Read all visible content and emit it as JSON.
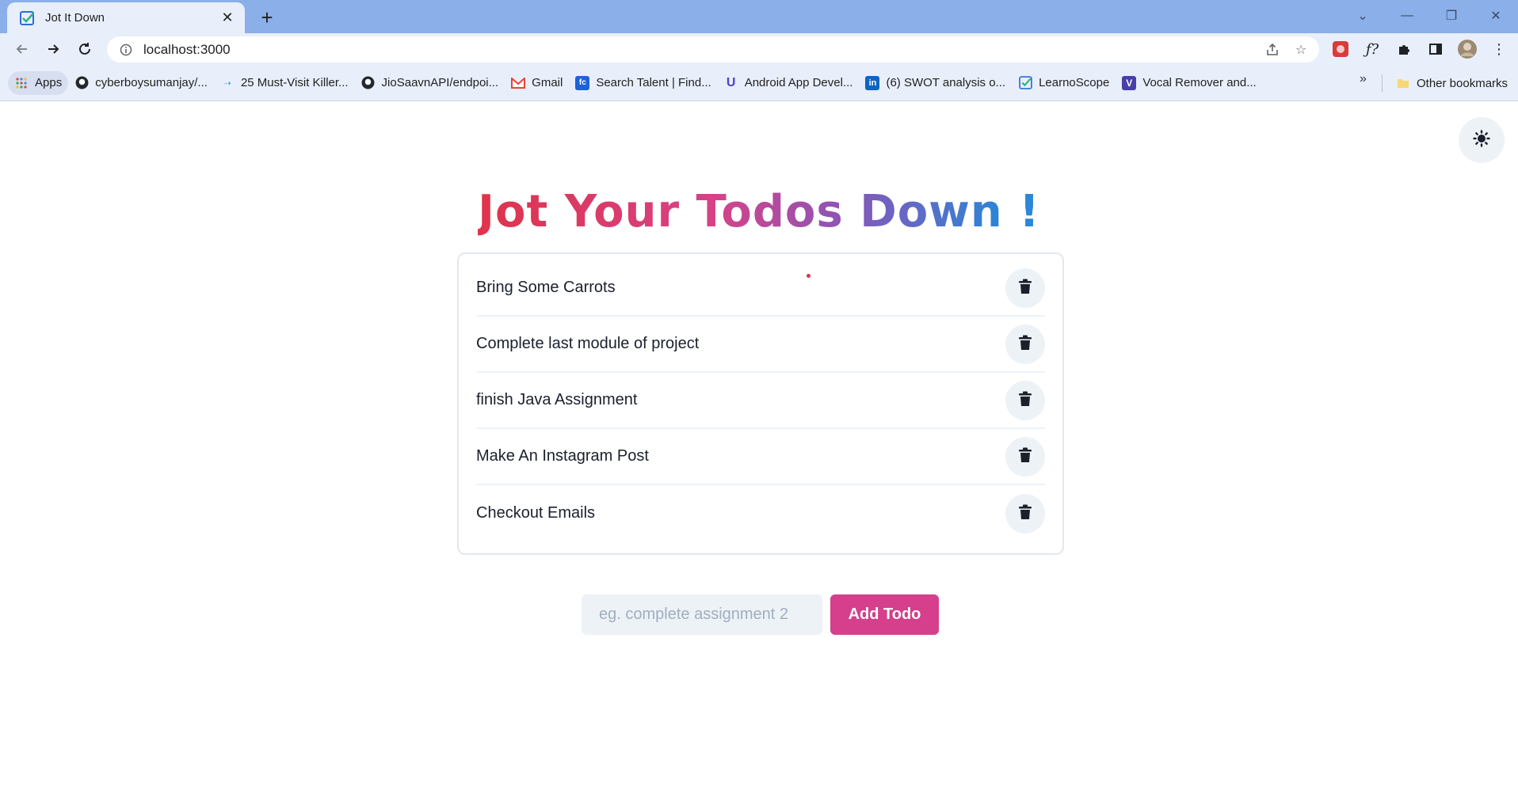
{
  "browser": {
    "tab": {
      "title": "Jot It Down",
      "icon": "checkbox-favicon-icon"
    },
    "address": "localhost:3000",
    "bookmarks": [
      {
        "label": "Apps",
        "icon": "apps-grid-icon"
      },
      {
        "label": "cyberboysumanjay/...",
        "icon": "github-icon"
      },
      {
        "label": "25 Must-Visit Killer...",
        "icon": "arrow-icon"
      },
      {
        "label": "JioSaavnAPI/endpoi...",
        "icon": "github-icon"
      },
      {
        "label": "Gmail",
        "icon": "gmail-icon"
      },
      {
        "label": "Search Talent | Find...",
        "icon": "fc-icon"
      },
      {
        "label": "Android App Devel...",
        "icon": "udacity-icon"
      },
      {
        "label": "(6) SWOT analysis o...",
        "icon": "linkedin-icon"
      },
      {
        "label": "LearnoScope",
        "icon": "learnoscope-icon"
      },
      {
        "label": "Vocal Remover and...",
        "icon": "v-icon"
      }
    ],
    "more": "»",
    "other_bookmarks": "Other bookmarks"
  },
  "page": {
    "headline": "Jot Your Todos Down",
    "headline_mark": "!",
    "todos": [
      "Bring Some Carrots",
      "Complete last module of project",
      "finish Java Assignment",
      "Make An Instagram Post",
      "Checkout Emails"
    ],
    "input_placeholder": "eg. complete assignment 2",
    "add_button": "Add Todo"
  },
  "colors": {
    "accent_pink": "#d53f8c",
    "title_red": "#e0334a",
    "title_blue": "#2b87d8",
    "chrome_blue": "#8aafe9"
  }
}
